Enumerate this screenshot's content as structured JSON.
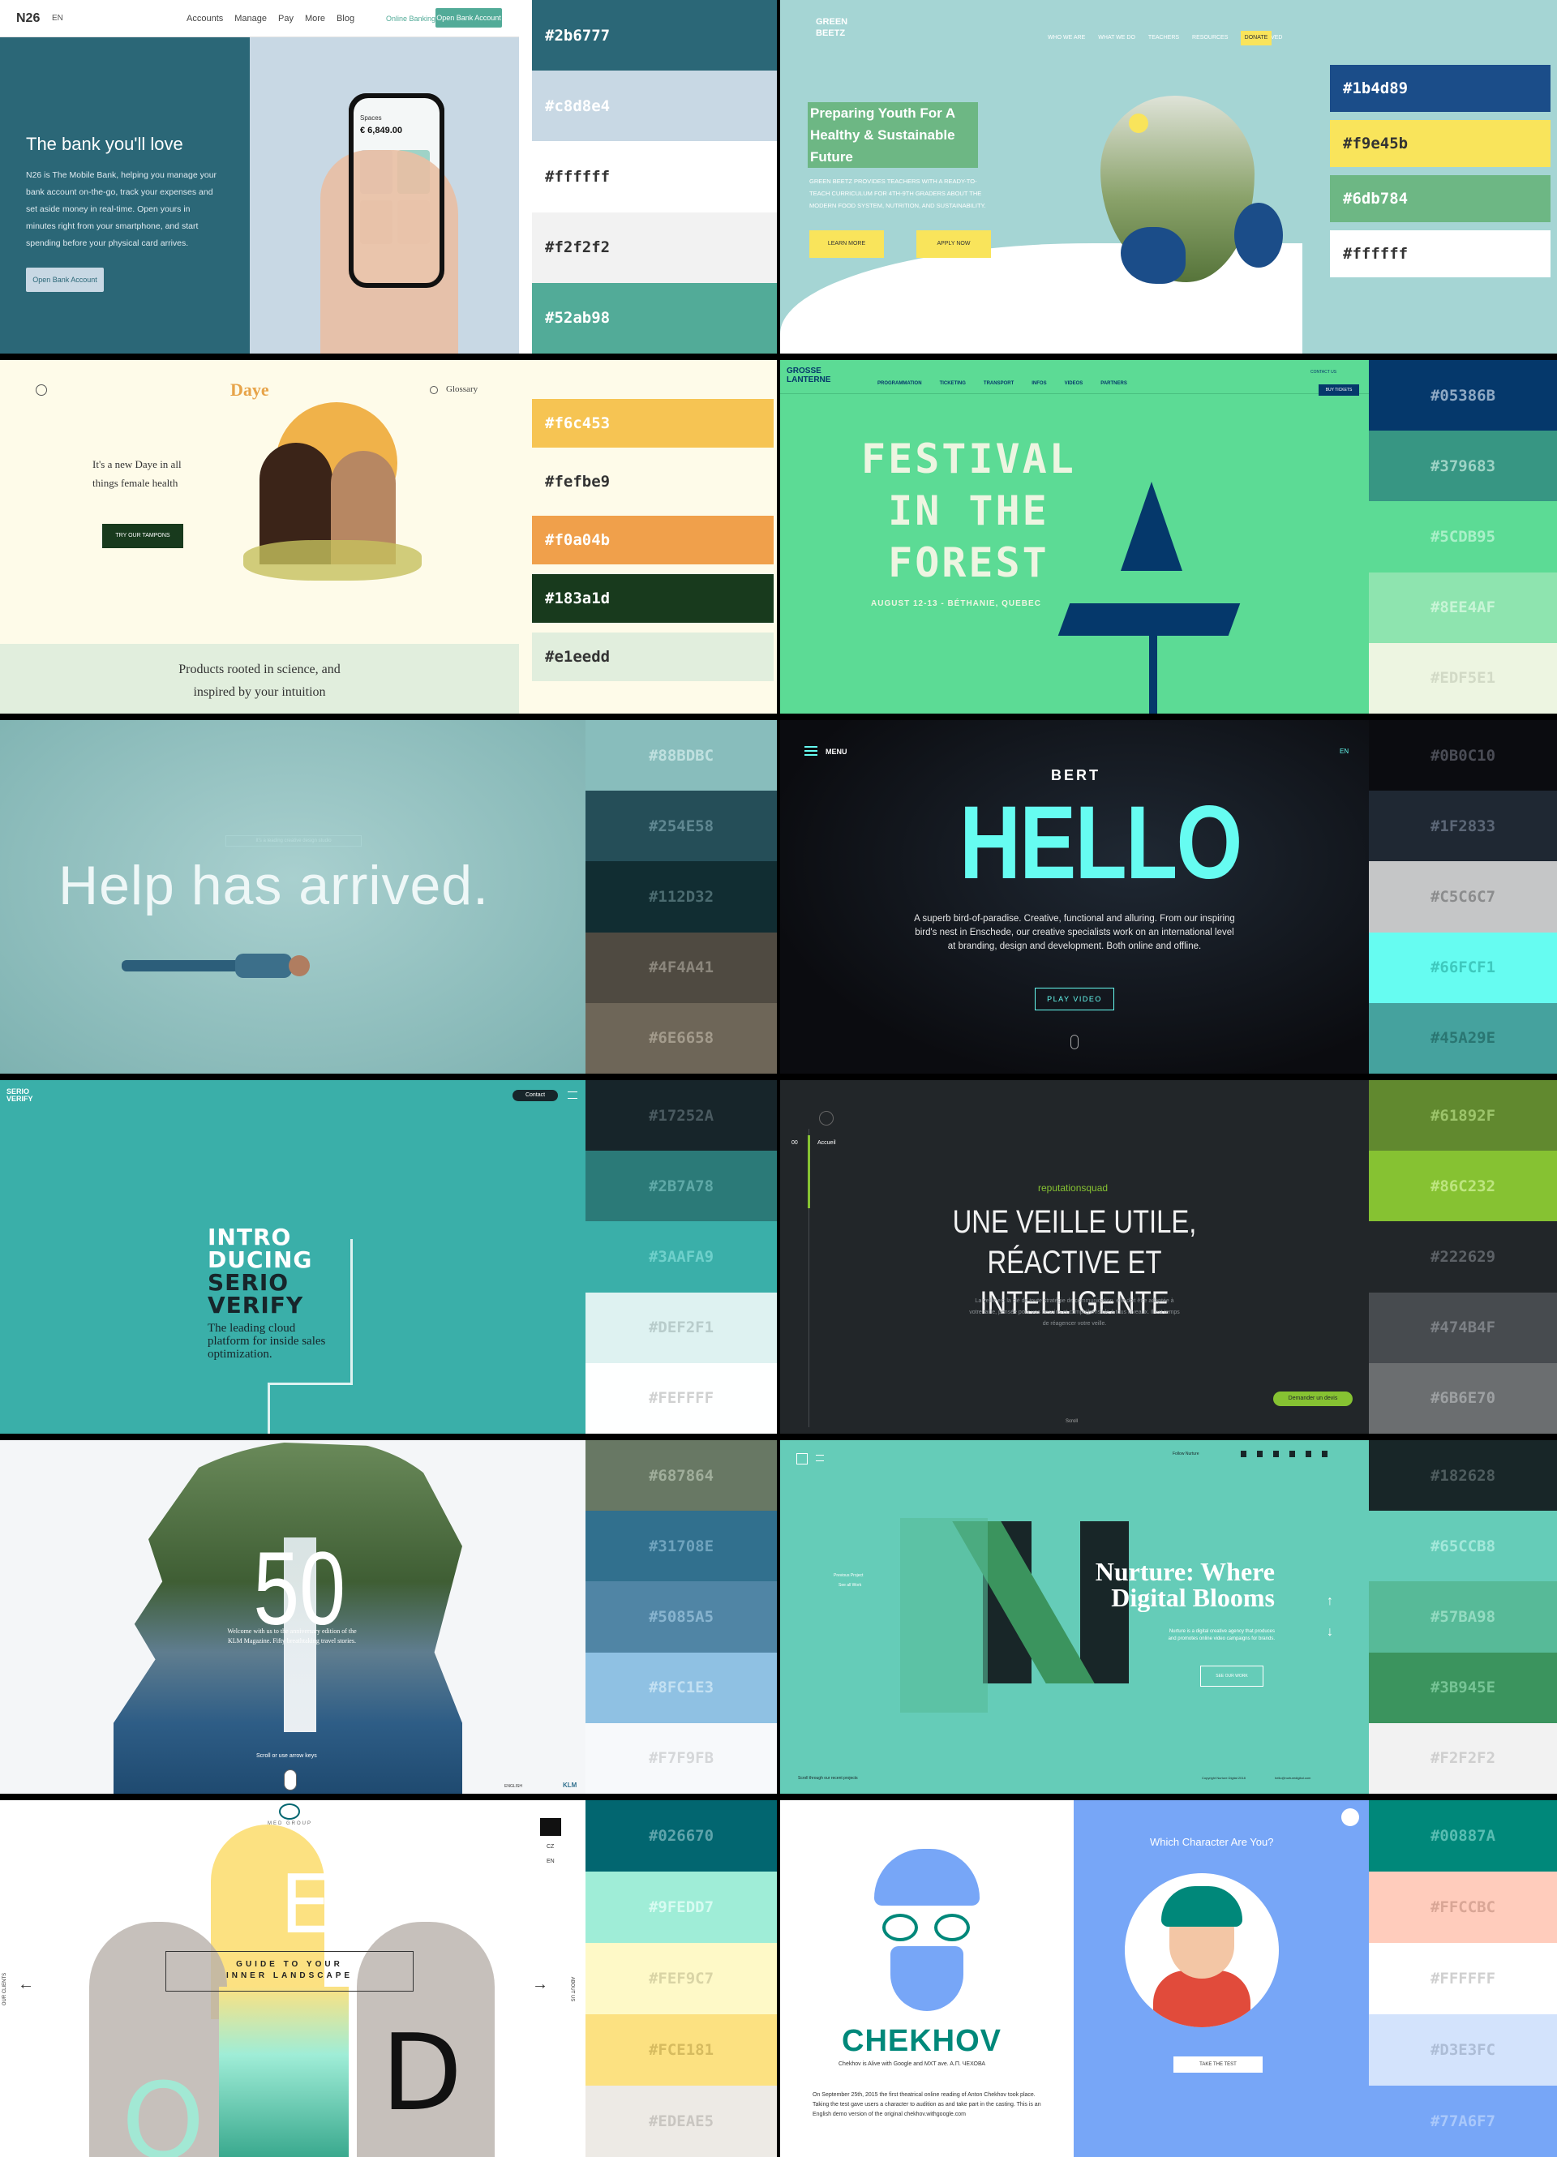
{
  "cards": [
    {
      "name": "n26",
      "nav": {
        "logo": "N26",
        "lang": "EN",
        "links": [
          "Accounts",
          "Manage",
          "Pay",
          "More",
          "Blog"
        ],
        "online_banking": "Online Banking",
        "cta": "Open Bank Account"
      },
      "hero": {
        "title": "The bank you'll love",
        "body": "N26 is The Mobile Bank, helping you manage your bank account on-the-go, track your expenses and set aside money in real-time. Open yours in minutes right from your smartphone, and start spending before your physical card arrives.",
        "button": "Open Bank Account"
      },
      "phone": {
        "label": "Spaces",
        "amount": "€ 6,849.00"
      },
      "palette": [
        {
          "hex": "#2b6777",
          "color": "#2b6777",
          "text": "#ffffff"
        },
        {
          "hex": "#c8d8e4",
          "color": "#c8d8e4",
          "text": "#ffffff"
        },
        {
          "hex": "#ffffff",
          "color": "#ffffff",
          "text": "#333333"
        },
        {
          "hex": "#f2f2f2",
          "color": "#f2f2f2",
          "text": "#333333"
        },
        {
          "hex": "#52ab98",
          "color": "#52ab98",
          "text": "#ffffff"
        }
      ]
    },
    {
      "name": "greenbeetz",
      "logo": "GREEN BEETZ",
      "nav": [
        "WHO WE ARE",
        "WHAT WE DO",
        "TEACHERS",
        "RESOURCES",
        "GET INVOLVED"
      ],
      "donate": "DONATE",
      "hero": {
        "title": "Preparing Youth For A Healthy & Sustainable Future",
        "body": "GREEN BEETZ PROVIDES TEACHERS WITH A READY-TO-TEACH CURRICULUM FOR 4TH-9TH GRADERS ABOUT THE MODERN FOOD SYSTEM, NUTRITION, AND SUSTAINABILITY.",
        "btn1": "LEARN MORE",
        "btn2": "APPLY NOW"
      },
      "palette": [
        {
          "hex": "#1b4d89",
          "color": "#1b4d89",
          "text": "#ffffff"
        },
        {
          "hex": "#f9e45b",
          "color": "#f9e45b",
          "text": "#333333"
        },
        {
          "hex": "#6db784",
          "color": "#6db784",
          "text": "#ffffff"
        },
        {
          "hex": "#ffffff",
          "color": "#ffffff",
          "text": "#333333"
        }
      ]
    },
    {
      "name": "daye",
      "logo": "Daye",
      "glossary": "Glossary",
      "hero": {
        "title": "It's a new Daye in all things female health",
        "button": "TRY OUR TAMPONS"
      },
      "footer": "Products rooted in science, and inspired by your intuition",
      "palette": [
        {
          "hex": "#f6c453",
          "color": "#f6c453",
          "text": "#ffffff"
        },
        {
          "hex": "#fefbe9",
          "color": "#fefbe9",
          "text": "#333333"
        },
        {
          "hex": "#f0a04b",
          "color": "#f0a04b",
          "text": "#ffffff"
        },
        {
          "hex": "#183a1d",
          "color": "#183a1d",
          "text": "#ffffff"
        },
        {
          "hex": "#e1eedd",
          "color": "#e1eedd",
          "text": "#333333"
        }
      ]
    },
    {
      "name": "grosselanterne",
      "logo": "GROSSE LANTERNE",
      "nav": [
        "PROGRAMMATION",
        "TICKETING",
        "TRANSPORT",
        "INFOS",
        "VIDEOS",
        "PARTNERS"
      ],
      "contact": "CONTACT US",
      "buy": "BUY TICKETS",
      "hero": {
        "line1": "FESTIVAL",
        "line2": "IN THE",
        "line3": "FOREST",
        "date": "AUGUST 12-13 - BÉTHANIE, QUEBEC"
      },
      "palette": [
        {
          "hex": "#05386B",
          "color": "#05386B",
          "text": "#8fa9c4"
        },
        {
          "hex": "#379683",
          "color": "#379683",
          "text": "#9dd3c5"
        },
        {
          "hex": "#5CDB95",
          "color": "#5CDB95",
          "text": "#a9f0c8"
        },
        {
          "hex": "#8EE4AF",
          "color": "#8EE4AF",
          "text": "#c8f5d6"
        },
        {
          "hex": "#EDF5E1",
          "color": "#EDF5E1",
          "text": "#d2dac6"
        }
      ]
    },
    {
      "name": "help",
      "hero": {
        "title": "Help has arrived.",
        "tag": "It's a leading creative design studio"
      },
      "palette": [
        {
          "hex": "#88BDBC",
          "color": "#88BDBC",
          "text": "#bfe0df"
        },
        {
          "hex": "#254E58",
          "color": "#254E58",
          "text": "#5f8791"
        },
        {
          "hex": "#112D32",
          "color": "#112D32",
          "text": "#4b6b70"
        },
        {
          "hex": "#4F4A41",
          "color": "#4F4A41",
          "text": "#8b867c"
        },
        {
          "hex": "#6E6658",
          "color": "#6E6658",
          "text": "#a39b8c"
        }
      ]
    },
    {
      "name": "bert",
      "menu": "MENU",
      "lang": "EN",
      "logo": "BERT",
      "hero": {
        "title": "HELLO",
        "body": "A superb bird-of-paradise. Creative, functional and alluring. From our inspiring bird's nest in Enschede, our creative specialists work on an international level at branding, design and development. Both online and offline.",
        "button": "PLAY VIDEO"
      },
      "palette": [
        {
          "hex": "#0B0C10",
          "color": "#0B0C10",
          "text": "#4a4c55"
        },
        {
          "hex": "#1F2833",
          "color": "#1F2833",
          "text": "#5b6676"
        },
        {
          "hex": "#C5C6C7",
          "color": "#C5C6C7",
          "text": "#8b8c8d"
        },
        {
          "hex": "#66FCF1",
          "color": "#66FCF1",
          "text": "#3fc9be"
        },
        {
          "hex": "#45A29E",
          "color": "#45A29E",
          "text": "#2a7672"
        }
      ]
    },
    {
      "name": "serio",
      "logo": "SERIO VERIFY",
      "contact": "Contact",
      "hero": {
        "line1": "INTRO",
        "line2": "DUCING",
        "line3": "SERIO",
        "line4": "VERIFY",
        "body": "The leading cloud platform for inside sales optimization."
      },
      "palette": [
        {
          "hex": "#17252A",
          "color": "#17252A",
          "text": "#4a5a60"
        },
        {
          "hex": "#2B7A78",
          "color": "#2B7A78",
          "text": "#5fa9a7"
        },
        {
          "hex": "#3AAFA9",
          "color": "#3AAFA9",
          "text": "#6fd0cb"
        },
        {
          "hex": "#DEF2F1",
          "color": "#DEF2F1",
          "text": "#b8cccb"
        },
        {
          "hex": "#FEFFFF",
          "color": "#FEFFFF",
          "text": "#d0d1d1"
        }
      ]
    },
    {
      "name": "reputation",
      "nav_num": "00",
      "nav_label": "Accueil",
      "brand": "reputationsquad",
      "hero": {
        "line1": "UNE VEILLE UTILE,",
        "line2": "RÉACTIVE ET INTELLIGENTE",
        "body": "La veille est la clé de toute stratégie de communication, elle doit être adaptée à votre taille, pensée pour vos besoins et compréhensible à tous niveaux. Il est temps de réagencer votre veille.",
        "button": "Demander un devis",
        "scroll": "Scroll"
      },
      "palette": [
        {
          "hex": "#61892F",
          "color": "#61892F",
          "text": "#9cc46a"
        },
        {
          "hex": "#86C232",
          "color": "#86C232",
          "text": "#bde57f"
        },
        {
          "hex": "#222629",
          "color": "#222629",
          "text": "#5c6166"
        },
        {
          "hex": "#474B4F",
          "color": "#474B4F",
          "text": "#7c8085"
        },
        {
          "hex": "#6B6E70",
          "color": "#6B6E70",
          "text": "#9da0a2"
        }
      ]
    },
    {
      "name": "fifty",
      "hero": {
        "number": "50",
        "body": "Welcome with us to the anniversary edition of the KLM Magazine. Fifty breathtaking travel stories.",
        "scroll": "Scroll or use arrow keys"
      },
      "lang": "ENGLISH",
      "logo": "KLM",
      "palette": [
        {
          "hex": "#687864",
          "color": "#687864",
          "text": "#a0ae9b"
        },
        {
          "hex": "#31708E",
          "color": "#31708E",
          "text": "#6fa3bd"
        },
        {
          "hex": "#5085A5",
          "color": "#5085A5",
          "text": "#88b4cf"
        },
        {
          "hex": "#8FC1E3",
          "color": "#8FC1E3",
          "text": "#c3e0f2"
        },
        {
          "hex": "#F7F9FB",
          "color": "#F7F9FB",
          "text": "#d5d7d9"
        }
      ]
    },
    {
      "name": "nurture",
      "follow": "Follow Nurture",
      "hero": {
        "title1": "Nurture: Where",
        "title2": "Digital Blooms",
        "body": "Nurture is a digital creative agency that produces and promotes online video campaigns for brands.",
        "button": "SEE OUR WORK",
        "prev": "Previous Project",
        "see": "See all Work",
        "scroll": "Scroll through our recent projects",
        "copy": "Copyright Nurture Digital 2018",
        "email": "hello@nurturedigital.com"
      },
      "palette": [
        {
          "hex": "#182628",
          "color": "#182628",
          "text": "#4e5c5e"
        },
        {
          "hex": "#65CCB8",
          "color": "#65CCB8",
          "text": "#a3e8da"
        },
        {
          "hex": "#57BA98",
          "color": "#57BA98",
          "text": "#93dbc1"
        },
        {
          "hex": "#3B945E",
          "color": "#3B945E",
          "text": "#76c495"
        },
        {
          "hex": "#F2F2F2",
          "color": "#F2F2F2",
          "text": "#cfcfcf"
        }
      ]
    },
    {
      "name": "medgroup",
      "logo": "MED GROUP",
      "clients": "OUR CLIENTS",
      "about": "ABOUT US",
      "lang1": "CZ",
      "lang2": "EN",
      "hero": {
        "line1": "GUIDE TO YOUR",
        "line2": "INNER LANDSCAPE"
      },
      "palette": [
        {
          "hex": "#026670",
          "color": "#026670",
          "text": "#5fa4ab"
        },
        {
          "hex": "#9FEDD7",
          "color": "#9FEDD7",
          "text": "#d7fbf1"
        },
        {
          "hex": "#FEF9C7",
          "color": "#FEF9C7",
          "text": "#d9d4a5"
        },
        {
          "hex": "#FCE181",
          "color": "#FCE181",
          "text": "#d6bb5f"
        },
        {
          "hex": "#EDEAE5",
          "color": "#EDEAE5",
          "text": "#c9c6c1"
        }
      ]
    },
    {
      "name": "chekhov",
      "hero": {
        "title": "CHEKHOV",
        "subtitle": "Chekhov is Alive with Google and MXT ave. A.П. ЧЕХОВА",
        "body": "On September 25th, 2015 the first theatrical online reading of Anton Chekhov took place. Taking the test gave users a character to audition as and take part in the casting. This is an English demo version of the original chekhov.withgoogle.com"
      },
      "question": "Which Character Are You?",
      "button": "TAKE THE TEST",
      "palette": [
        {
          "hex": "#00887A",
          "color": "#00887A",
          "text": "#59bdb2"
        },
        {
          "hex": "#FFCCBC",
          "color": "#FFCCBC",
          "text": "#d9a696"
        },
        {
          "hex": "#FFFFFF",
          "color": "#FFFFFF",
          "text": "#d0d0d0"
        },
        {
          "hex": "#D3E3FC",
          "color": "#D3E3FC",
          "text": "#adbdd6"
        },
        {
          "hex": "#77A6F7",
          "color": "#77A6F7",
          "text": "#a9c8fb"
        }
      ]
    }
  ]
}
